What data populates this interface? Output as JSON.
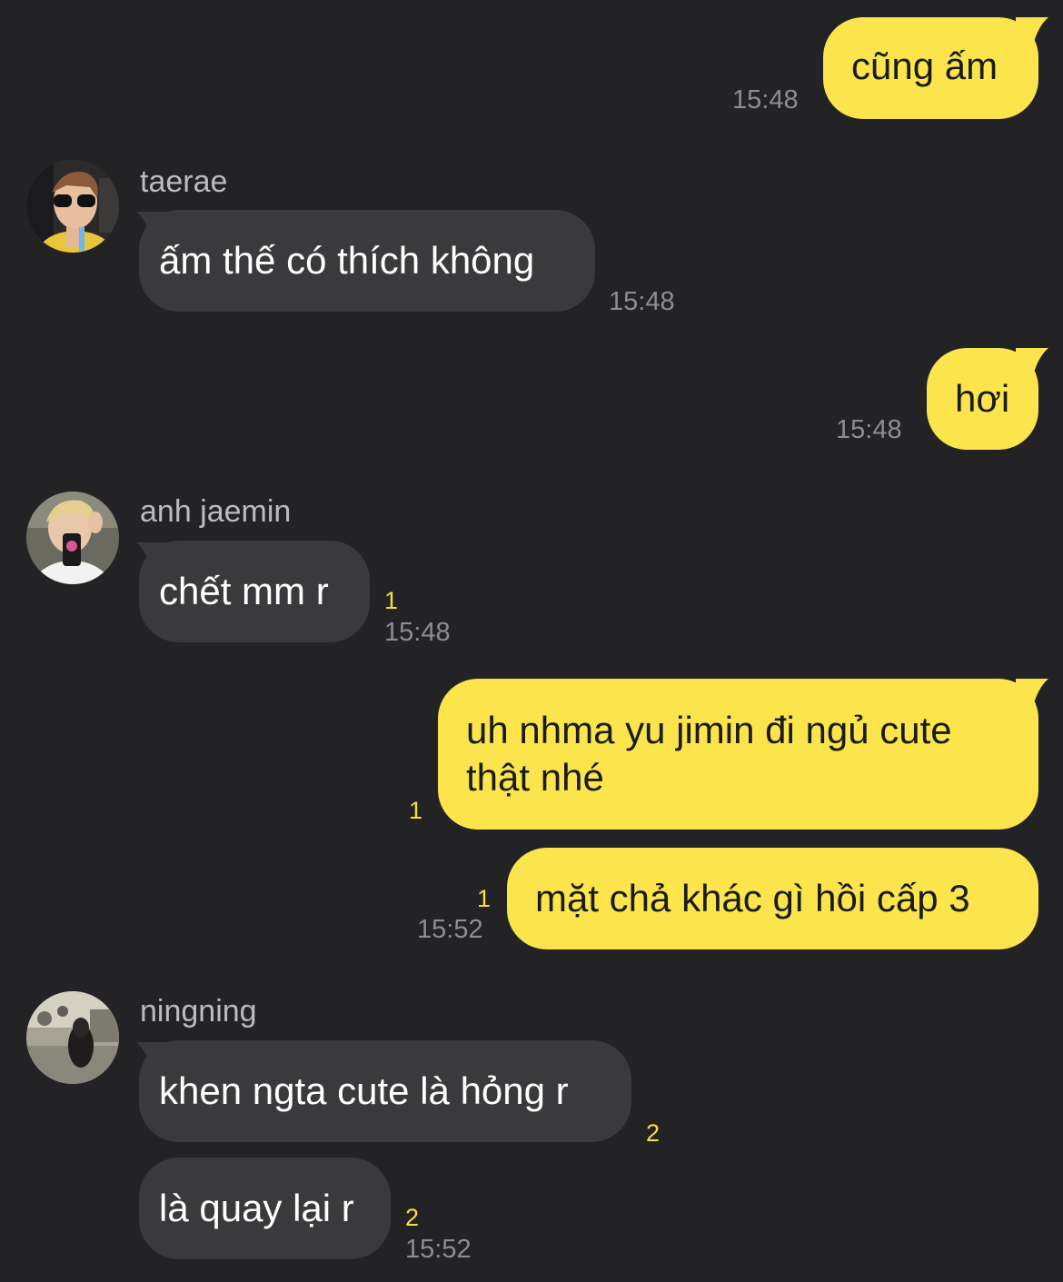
{
  "theme": {
    "background": "#232325",
    "my_bubble": "#fce54c",
    "their_bubble": "#3a3a3c",
    "unread_color": "#f7df3b",
    "time_color": "#8e8e92"
  },
  "messages": [
    {
      "sender": "me",
      "text": "cũng ấm",
      "time": "15:48"
    },
    {
      "sender": "taerae",
      "text": "ấm thế có thích không",
      "time": "15:48"
    },
    {
      "sender": "me",
      "text": "hơi",
      "time": "15:48"
    },
    {
      "sender": "anh jaemin",
      "text": "chết mm r",
      "unread": "1",
      "time": "15:48"
    },
    {
      "sender": "me",
      "text_line1": "uh nhma yu jimin đi ngủ cute",
      "text_line2": "thật nhé",
      "unread": "1"
    },
    {
      "sender": "me",
      "text": "mặt chả khác gì hồi cấp 3",
      "unread": "1",
      "time": "15:52"
    },
    {
      "sender": "ningning",
      "text": "khen ngta cute là hỏng r",
      "unread": "2"
    },
    {
      "sender": "ningning",
      "text": "là quay lại r",
      "unread": "2",
      "time": "15:52"
    }
  ],
  "senders": {
    "taerae": {
      "name": "taerae",
      "avatar_icon": "profile-photo-icon"
    },
    "jaemin": {
      "name": "anh jaemin",
      "avatar_icon": "profile-photo-icon"
    },
    "ningning": {
      "name": "ningning",
      "avatar_icon": "profile-photo-icon"
    }
  }
}
